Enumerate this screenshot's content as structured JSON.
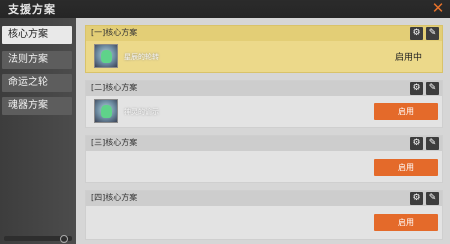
{
  "window": {
    "title": "支援方案",
    "close_icon": "close-icon"
  },
  "sidebar": {
    "items": [
      {
        "label": "核心方案",
        "active": true
      },
      {
        "label": "法则方案",
        "active": false
      },
      {
        "label": "命运之轮",
        "active": false
      },
      {
        "label": "魂器方案",
        "active": false
      }
    ]
  },
  "plans": [
    {
      "title": "[一]核心方案",
      "item_name": "星辰的轮转",
      "status": "启用中",
      "active": true
    },
    {
      "title": "[二]核心方案",
      "item_name": "神灵的谕示",
      "button": "启用",
      "active": false
    },
    {
      "title": "[三]核心方案",
      "button": "启用",
      "active": false
    },
    {
      "title": "[四]核心方案",
      "button": "启用",
      "active": false
    }
  ],
  "colors": {
    "accent": "#e46a2a",
    "active_card": "#ecd98a"
  }
}
